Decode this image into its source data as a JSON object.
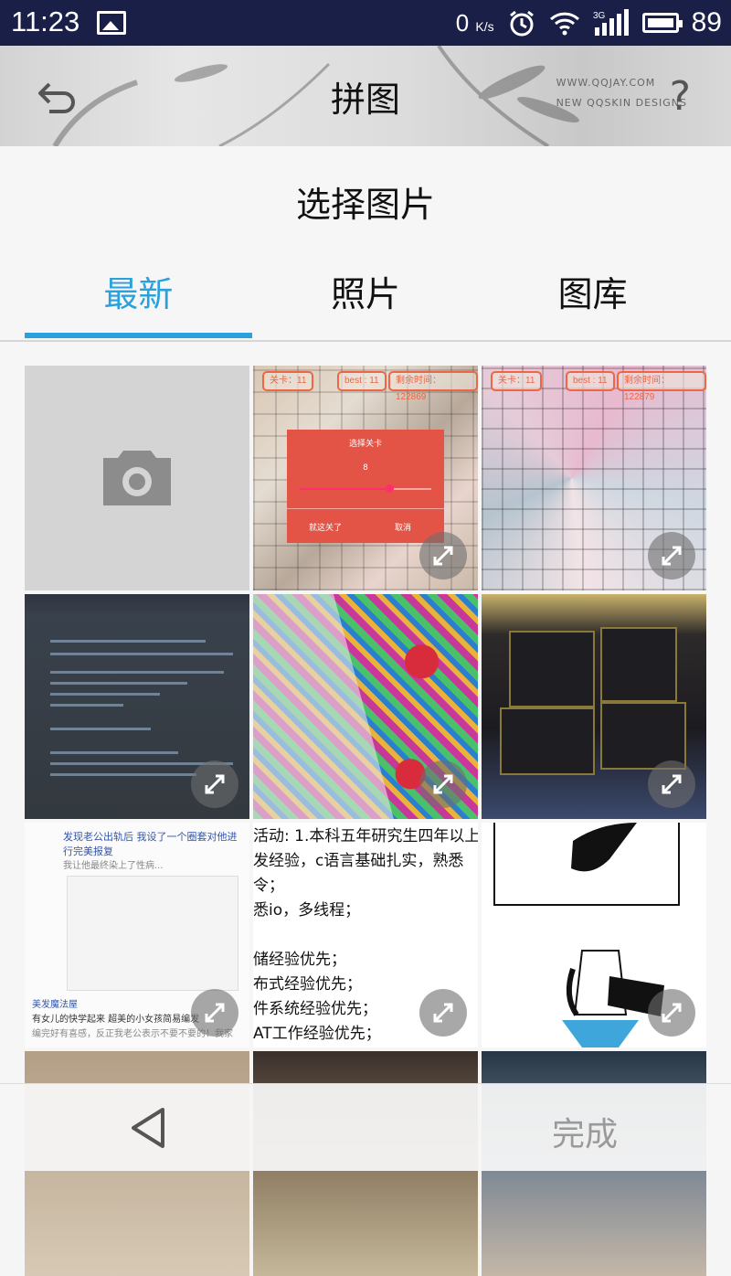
{
  "status_bar": {
    "time": "11:23",
    "net_speed": "0",
    "net_speed_unit": "K/s",
    "network_type": "3G",
    "battery": "89",
    "icons": [
      "image-icon",
      "alarm-icon",
      "wifi-icon",
      "signal-icon",
      "battery-icon"
    ]
  },
  "app_bar": {
    "title": "拼图",
    "watermark_line1": "WWW.QQJAY.COM",
    "watermark_line2": "NEW QQSKIN DESIGNS",
    "help_label": "?"
  },
  "picker": {
    "title": "选择图片",
    "tabs": [
      {
        "label": "最新",
        "active": true
      },
      {
        "label": "照片",
        "active": false
      },
      {
        "label": "图库",
        "active": false
      }
    ],
    "accent_color": "#2aa0dc"
  },
  "grid": {
    "puzzle1": {
      "level_label": "关卡：11",
      "best": "best : 11",
      "time": "剩余时间：122869",
      "dialog_title": "选择关卡",
      "dialog_value": "8",
      "dialog_ok": "就这关了",
      "dialog_cancel": "取消"
    },
    "puzzle2": {
      "level_label": "关卡：11",
      "best": "best : 11",
      "time": "剩余时间：122879"
    },
    "chat": {
      "headline": "发现老公出轨后 我设了一个圈套对他进行完美报复",
      "sub": "我让他最终染上了性病...",
      "footer_name": "美发魔法屋",
      "footer_text": "有女儿的快学起来 超美的小女孩简易编发",
      "footer_text2": "编完好有喜感，反正我老公表示不要不要的！我家"
    },
    "text_image_lines": [
      "活动: 1.本科五年研究生四年以上",
      "发经验，c语言基础扎实，熟悉",
      "令；",
      "悉io，多线程；",
      "",
      "储经验优先；",
      "布式经验优先；",
      "件系统经验优先；",
      "AT工作经验优先；"
    ]
  },
  "bottom_bar": {
    "back_label": "back",
    "done_label": "完成"
  }
}
